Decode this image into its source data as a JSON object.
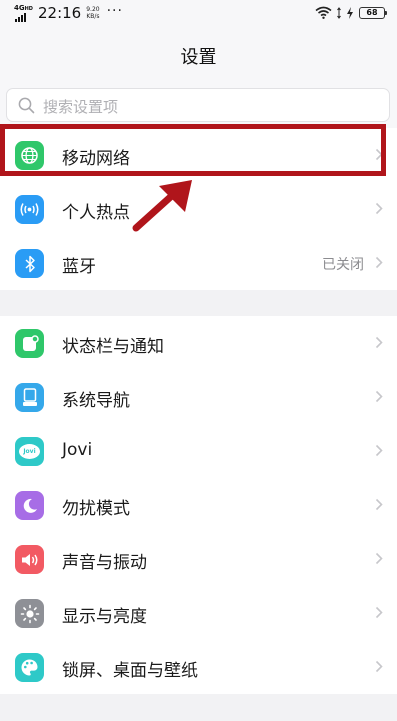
{
  "status_bar": {
    "network": "4G",
    "network_sup": "HD",
    "time": "22:16",
    "speed_value": "9.20",
    "speed_unit": "KB/s",
    "more": "···",
    "battery": "68"
  },
  "header": {
    "title": "设置"
  },
  "search": {
    "placeholder": "搜索设置项",
    "icon": "search-icon"
  },
  "section1": {
    "items": [
      {
        "label": "移动网络",
        "icon": "globe-icon",
        "color": "#2fc76a",
        "value": ""
      },
      {
        "label": "个人热点",
        "icon": "hotspot-icon",
        "color": "#2a9cf5",
        "value": ""
      },
      {
        "label": "蓝牙",
        "icon": "bluetooth-icon",
        "color": "#2a9cf5",
        "value": "已关闭"
      }
    ]
  },
  "section2": {
    "items": [
      {
        "label": "状态栏与通知",
        "icon": "notification-icon",
        "color": "#2fc76a"
      },
      {
        "label": "系统导航",
        "icon": "navigation-icon",
        "color": "#35a8ea"
      },
      {
        "label": "Jovi",
        "icon": "jovi-icon",
        "color": "#2ec9c8",
        "badge": "Jovi"
      },
      {
        "label": "勿扰模式",
        "icon": "moon-icon",
        "color": "#a76de6"
      },
      {
        "label": "声音与振动",
        "icon": "speaker-icon",
        "color": "#f25a63"
      },
      {
        "label": "显示与亮度",
        "icon": "brightness-icon",
        "color": "#8e9096"
      },
      {
        "label": "锁屏、桌面与壁纸",
        "icon": "palette-icon",
        "color": "#2ec9c8"
      }
    ]
  },
  "annotation": {
    "color": "#b0151b"
  }
}
